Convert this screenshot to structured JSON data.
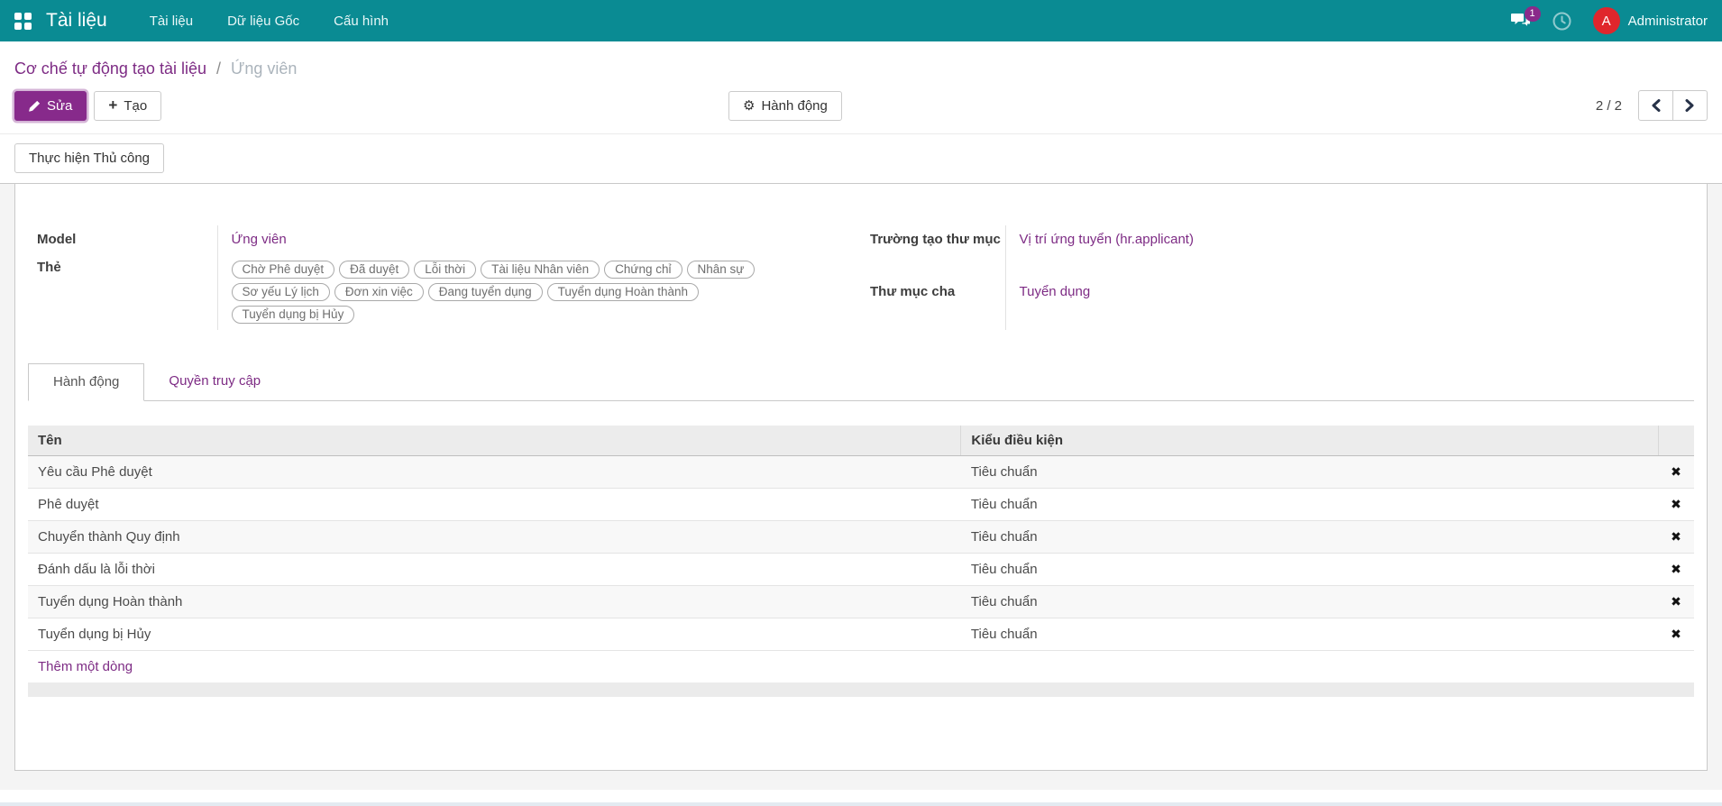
{
  "navbar": {
    "brand": "Tài liệu",
    "menus": [
      "Tài liệu",
      "Dữ liệu Gốc",
      "Cấu hình"
    ],
    "messages_badge": "1",
    "user": {
      "initial": "A",
      "name": "Administrator"
    }
  },
  "breadcrumb": {
    "parent": "Cơ chế tự động tạo tài liệu",
    "separator": "/",
    "current": "Ứng viên"
  },
  "control_panel": {
    "edit_label": "Sửa",
    "create_label": "Tạo",
    "action_label": "Hành động",
    "pager_count": "2 / 2"
  },
  "statusbar": {
    "manual_run_label": "Thực hiện Thủ công"
  },
  "form": {
    "fields": {
      "model": {
        "label": "Model",
        "value": "Ứng viên"
      },
      "tags": {
        "label": "Thẻ",
        "items": [
          "Chờ Phê duyệt",
          "Đã duyệt",
          "Lỗi thời",
          "Tài liệu Nhân viên",
          "Chứng chỉ",
          "Nhân sự",
          "Sơ yếu Lý lịch",
          "Đơn xin việc",
          "Đang tuyển dụng",
          "Tuyển dụng Hoàn thành",
          "Tuyển dụng bị Hủy"
        ]
      },
      "folder_field": {
        "label": "Trường tạo thư mục",
        "value": "Vị trí ứng tuyển (hr.applicant)"
      },
      "parent_folder": {
        "label": "Thư mục cha",
        "value": "Tuyển dụng"
      }
    },
    "tabs": [
      {
        "label": "Hành động"
      },
      {
        "label": "Quyền truy cập"
      }
    ],
    "table": {
      "headers": {
        "name": "Tên",
        "condition": "Kiểu điều kiện"
      },
      "rows": [
        {
          "name": "Yêu cầu Phê duyệt",
          "condition": "Tiêu chuẩn"
        },
        {
          "name": "Phê duyệt",
          "condition": "Tiêu chuẩn"
        },
        {
          "name": "Chuyển thành Quy định",
          "condition": "Tiêu chuẩn"
        },
        {
          "name": "Đánh dấu là lỗi thời",
          "condition": "Tiêu chuẩn"
        },
        {
          "name": "Tuyển dụng Hoàn thành",
          "condition": "Tiêu chuẩn"
        },
        {
          "name": "Tuyển dụng bị Hủy",
          "condition": "Tiêu chuẩn"
        }
      ],
      "add_line_label": "Thêm một dòng"
    }
  },
  "icons": {
    "plus": "+",
    "gear": "⚙",
    "delete": "✖"
  },
  "colors": {
    "navbar_teal": "#0a8b93",
    "primary_purple": "#872a8b",
    "link_purple": "#7d2b84",
    "avatar_red": "#e0262c",
    "badge_purple": "#8a2a8a"
  }
}
